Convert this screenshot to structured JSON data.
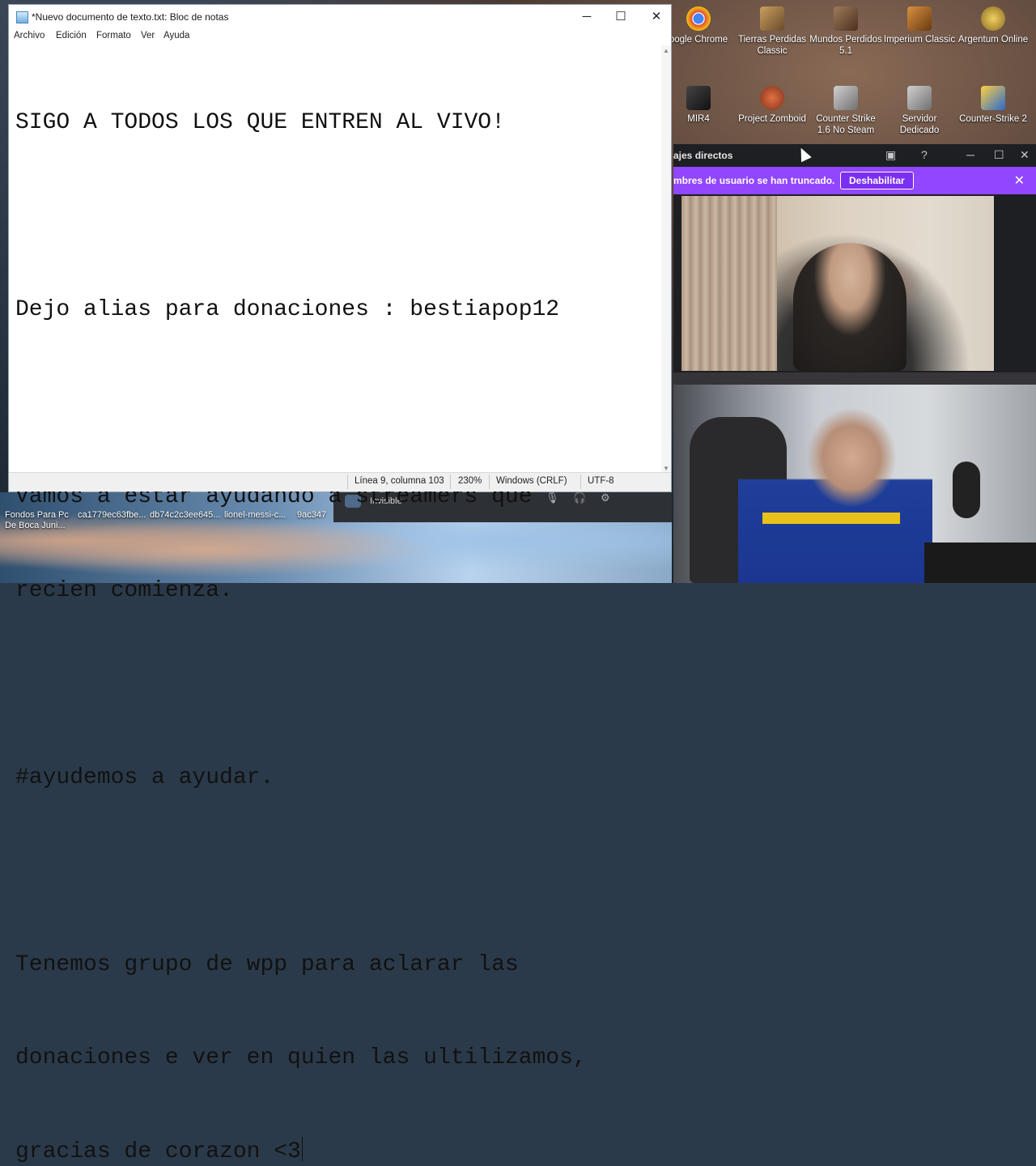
{
  "desktop": {
    "icons_top": [
      {
        "label": "oogle Chrome",
        "color": "#e24a3a"
      },
      {
        "label": "Tierras Perdidas Classic",
        "color": "#9a7a48"
      },
      {
        "label": "Mundos Perdidos 5.1",
        "color": "#7a5a3a"
      },
      {
        "label": "Imperium Classic",
        "color": "#b07a30"
      },
      {
        "label": "Argentum Online",
        "color": "#c8a030"
      }
    ],
    "icons_second": [
      {
        "label": "MIR4",
        "color": "#2a2a2a"
      },
      {
        "label": "Project Zomboid",
        "color": "#c04a2a"
      },
      {
        "label": "Counter Strike 1.6 No Steam",
        "color": "#8a8a8a"
      },
      {
        "label": "Servidor Dedicado",
        "color": "#8a8a8a"
      },
      {
        "label": "Counter-Strike 2",
        "color": "#2a6ad0"
      }
    ],
    "icons_bottom": [
      {
        "label": "Fondos Para Pc De Boca Juni..."
      },
      {
        "label": "ca1779ec63fbe..."
      },
      {
        "label": "db74c2c3ee645..."
      },
      {
        "label": "lionel-messi-c..."
      },
      {
        "label": "9ac347"
      }
    ]
  },
  "notepad": {
    "title": "*Nuevo documento de texto.txt: Bloc de notas",
    "controls": {
      "minimize": "─",
      "maximize": "☐",
      "close": "✕"
    },
    "menu": [
      "Archivo",
      "Edición",
      "Formato",
      "Ver",
      "Ayuda"
    ],
    "lines": [
      "SIGO A TODOS LOS QUE ENTREN AL VIVO!",
      "",
      "Dejo alias para donaciones : bestiapop12",
      "",
      "Vamos a estar ayudando a streamers que",
      "recien comienza.",
      "",
      "#ayudemos a ayudar.",
      "",
      "Tenemos grupo de wpp para aclarar las",
      "donaciones e ver en quien las ultilizamos,",
      "gracias de corazon <3"
    ],
    "status": {
      "position": "Línea 9, columna 103",
      "zoom": "230%",
      "line_ending": "Windows (CRLF)",
      "encoding": "UTF-8"
    }
  },
  "messenger": {
    "title": "ajes directos",
    "banner_text": "mbres de usuario se han truncado.",
    "disable_button": "Deshabilitar",
    "accent": "#9146ff"
  },
  "overlay": {
    "status_label": "Invisible"
  }
}
